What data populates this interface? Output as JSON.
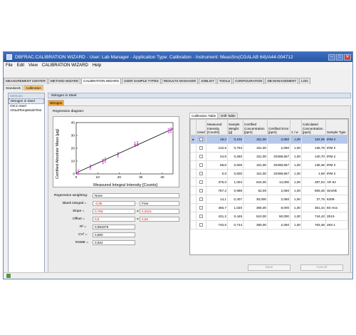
{
  "window": {
    "title": "DBFRAC.CALIBRATION WIZARD - User: Lab Manager - Application Type: Calibration - Instrument: MeasSrv(CGALAB 64)/A44-004712"
  },
  "menu": [
    "File",
    "Edit",
    "View",
    "CALIBRATION WIZARD",
    "Help"
  ],
  "tabs": [
    "MEASUREMENT CENTER",
    "METHOD WIZARD",
    "CALIBRATION WIZARD",
    "USER SAMPLE TYPES",
    "RESULTS MANAGER",
    "JOBLIST",
    "TOOLS",
    "CONFIGURATION",
    "DB MANAGEMENT",
    "LOG"
  ],
  "subtabs": [
    "Standards",
    "Calibration"
  ],
  "methods": {
    "header": "Methods",
    "items": [
      "Nitrogen in Steel",
      "ON in steel",
      "VirtualTempModeTest"
    ]
  },
  "method_header": "Nitrogen in Steel",
  "method_tab": "Nitrogen",
  "regression": {
    "diagram_label": "Regression diagram:",
    "weighting_label": "Regression weighting:",
    "weighting_value": "None",
    "blank_label": "Blank integral =",
    "blank_value": "-0,85",
    "blank_mode": "Free",
    "slope_label": "Slope =",
    "slope_value": "0,766",
    "slope_err": "0,0221",
    "offset_label": "Offset =",
    "offset_value": "0,8",
    "offset_err": "0,56",
    "r2_label": "R² =",
    "r2_value": "0,993378",
    "cv_label": "CV² =",
    "cv_value": "0,860",
    "rsme_label": "RSME =",
    "rsme_value": "0,922",
    "plusminus": "±"
  },
  "chart_data": {
    "type": "scatter",
    "xlabel": "Measured Integral Intensity [Counts]",
    "ylabel": "Certified Absolute Mass [µg]",
    "xlim": [
      0,
      45
    ],
    "ylim": [
      0,
      40
    ],
    "xticks": [
      0,
      10,
      20,
      30,
      40
    ],
    "yticks": [
      0,
      10,
      20,
      30,
      40
    ],
    "x": [
      1.0,
      6.6,
      12.4,
      13.5,
      19.4,
      27.3,
      28.5,
      43.0,
      44.0
    ],
    "y": [
      1.4,
      5.3,
      9.7,
      10.7,
      15.0,
      22.9,
      23.5,
      33.6,
      34.1
    ],
    "fit_line": {
      "x": [
        0,
        45
      ],
      "y": [
        0.8,
        35.3
      ]
    },
    "point_color": "#c13ac5",
    "line_color": "#000000"
  },
  "right_tabs": [
    "Calibration Table",
    "Drift Table"
  ],
  "table": {
    "columns": [
      "Used",
      "Measured Intensity [Counts]",
      "Sample Weight [g]",
      "Certified Concentration [ppm]",
      "Certified Error [ppm]",
      "1 / w",
      "Calculated Concentration [ppm]",
      "Sample Type"
    ],
    "rows": [
      [
        "19,2",
        "0,102",
        "151,00",
        "2,050",
        "1,00",
        "152,09",
        "IRM 2"
      ],
      [
        "132,5",
        "0,753",
        "151,00",
        "2,050",
        "1,00",
        "135,79",
        "IRM 2"
      ],
      [
        "44,9",
        "0,250",
        "151,00",
        "20498,557",
        "1,00",
        "140,70",
        "IRM 2"
      ],
      [
        "88,8",
        "0,505",
        "151,00",
        "20498,557",
        "1,00",
        "136,36",
        "IRM 2"
      ],
      [
        "0,0",
        "0,500",
        "151,00",
        "20498,557",
        "1,00",
        "1,69",
        "IRM 2"
      ],
      [
        "375,0",
        "1,004",
        "624,00",
        "14,000",
        "1,00",
        "287,04",
        "AR 64"
      ],
      [
        "787,2",
        "0,998",
        "62,00",
        "2,050",
        "1,00",
        "605,45",
        "StroNk"
      ],
      [
        "14,1",
        "0,407",
        "30,000",
        "2,050",
        "1,00",
        "37,75",
        "6308-"
      ],
      [
        "466,7",
        "1,020",
        "365,00",
        "8,000",
        "1,00",
        "351,44",
        "8S Hox"
      ],
      [
        "431,2",
        "0,445",
        "510,00",
        "50,000",
        "1,00",
        "744,43",
        "2813-"
      ],
      [
        "740,0",
        "0,744",
        "380,00",
        "2,050",
        "1,00",
        "763,38",
        "283-1"
      ]
    ]
  },
  "buttons": {
    "save": "Save",
    "cancel": "Cancel"
  }
}
